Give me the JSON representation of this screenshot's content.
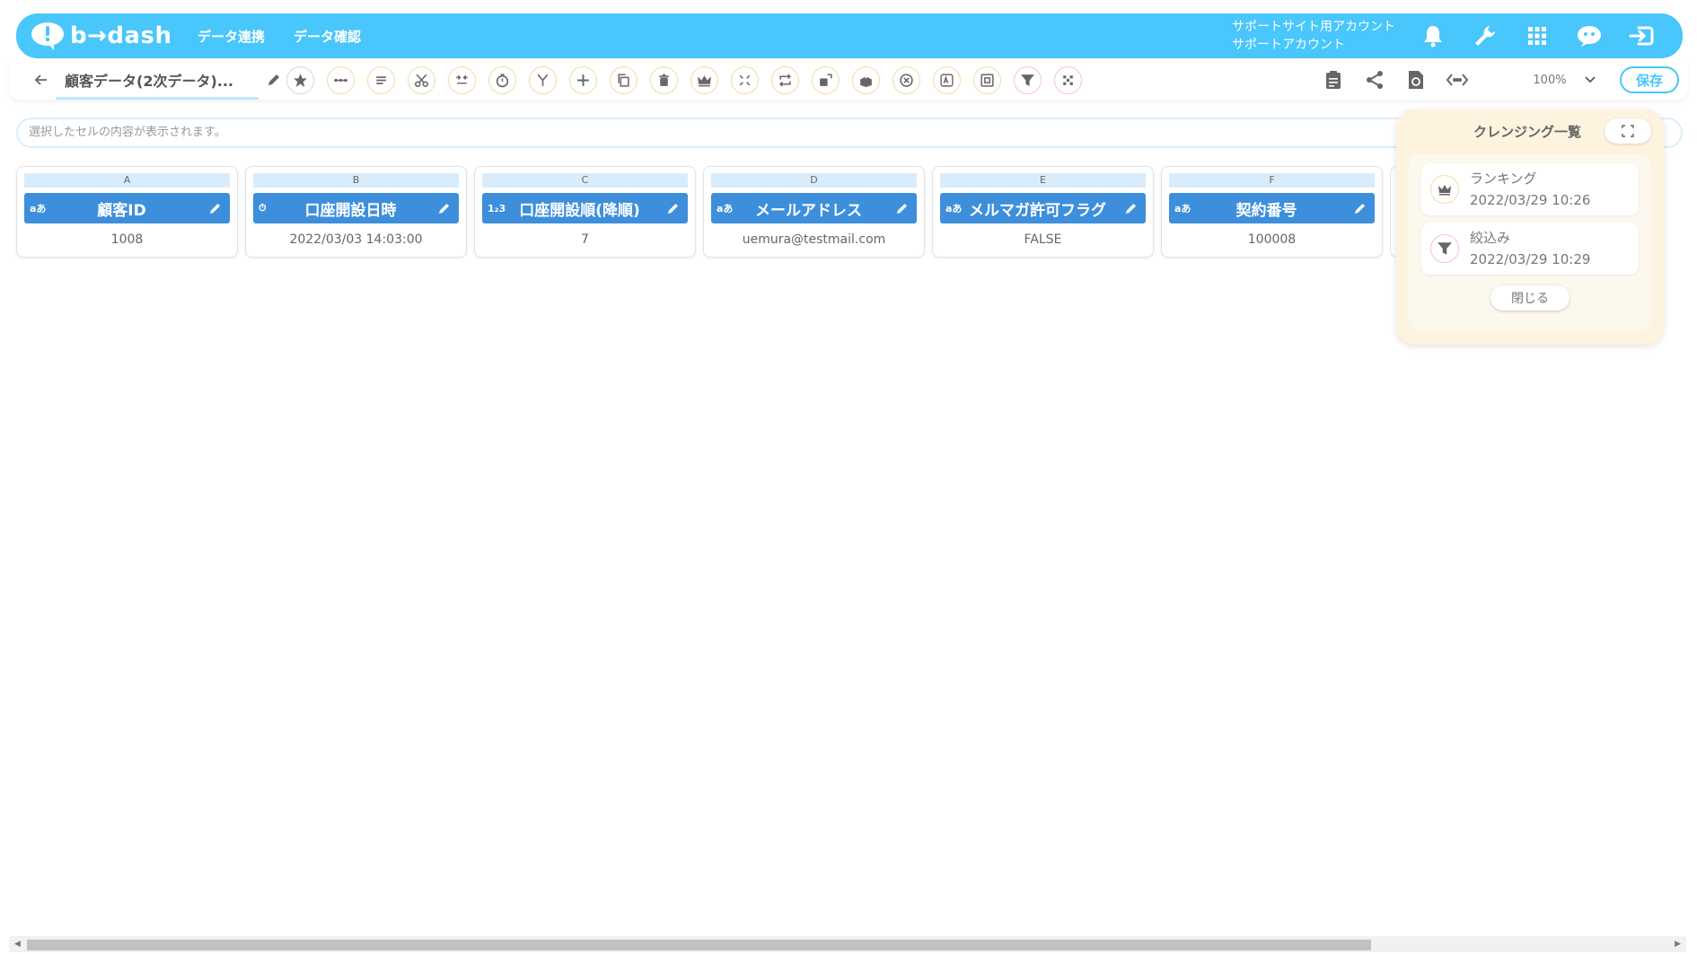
{
  "header": {
    "logo_text": "b→dash",
    "nav": [
      "データ連携",
      "データ確認"
    ],
    "account_line1": "サポートサイト用アカウント",
    "account_line2": "サポートアカウント"
  },
  "toolbar": {
    "title": "顧客データ(2次データ)...",
    "zoom": "100%",
    "save_label": "保存"
  },
  "cell_bar": {
    "placeholder": "選択したセルの内容が表示されます。"
  },
  "columns": [
    {
      "letter": "A",
      "type": "aあ",
      "name": "顧客ID",
      "value": "1008"
    },
    {
      "letter": "B",
      "type": "⏱",
      "name": "口座開設日時",
      "value": "2022/03/03 14:03:00"
    },
    {
      "letter": "C",
      "type": "1₂3",
      "name": "口座開設順(降順)",
      "value": "7"
    },
    {
      "letter": "D",
      "type": "aあ",
      "name": "メールアドレス",
      "value": "uemura@testmail.com"
    },
    {
      "letter": "E",
      "type": "aあ",
      "name": "メルマガ許可フラグ",
      "value": "FALSE"
    },
    {
      "letter": "F",
      "type": "aあ",
      "name": "契約番号",
      "value": "100008"
    }
  ],
  "cleansing": {
    "title": "クレンジング一覧",
    "items": [
      {
        "name": "ランキング",
        "date": "2022/03/29 10:26",
        "icon": "crown-icon"
      },
      {
        "name": "絞込み",
        "date": "2022/03/29 10:29",
        "icon": "filter-icon"
      }
    ],
    "close_label": "閉じる"
  },
  "colors": {
    "header_bg": "#49c6fb",
    "column_header": "#3d8fdc",
    "panel_bg": "#fdf3de"
  }
}
